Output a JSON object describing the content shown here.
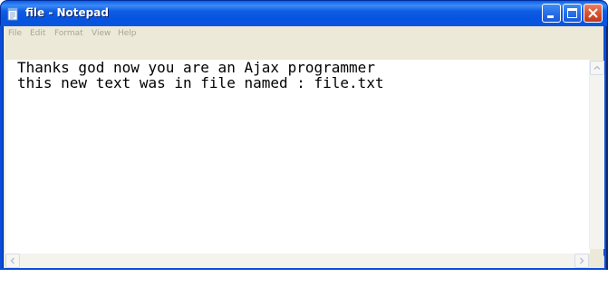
{
  "window": {
    "title": "file - Notepad"
  },
  "menu": {
    "items": [
      {
        "label": "File"
      },
      {
        "label": "Edit"
      },
      {
        "label": "Format"
      },
      {
        "label": "View"
      },
      {
        "label": "Help"
      }
    ]
  },
  "editor": {
    "lines": [
      "Thanks god now you are an Ajax programmer",
      "this new text was in file named : file.txt"
    ]
  },
  "icons": {
    "app": "notepad-icon",
    "minimize": "minimize-icon",
    "maximize": "maximize-icon",
    "close": "close-icon",
    "scroll_up": "arrow-up-icon",
    "scroll_down": "arrow-down-icon",
    "scroll_left": "arrow-left-icon",
    "scroll_right": "arrow-right-icon"
  },
  "colors": {
    "titlebar": "#0554e0",
    "close_button": "#d9532f",
    "menu_text_disabled": "#a8a49a",
    "editor_background": "#ffffff",
    "frame": "#ece9d8"
  }
}
